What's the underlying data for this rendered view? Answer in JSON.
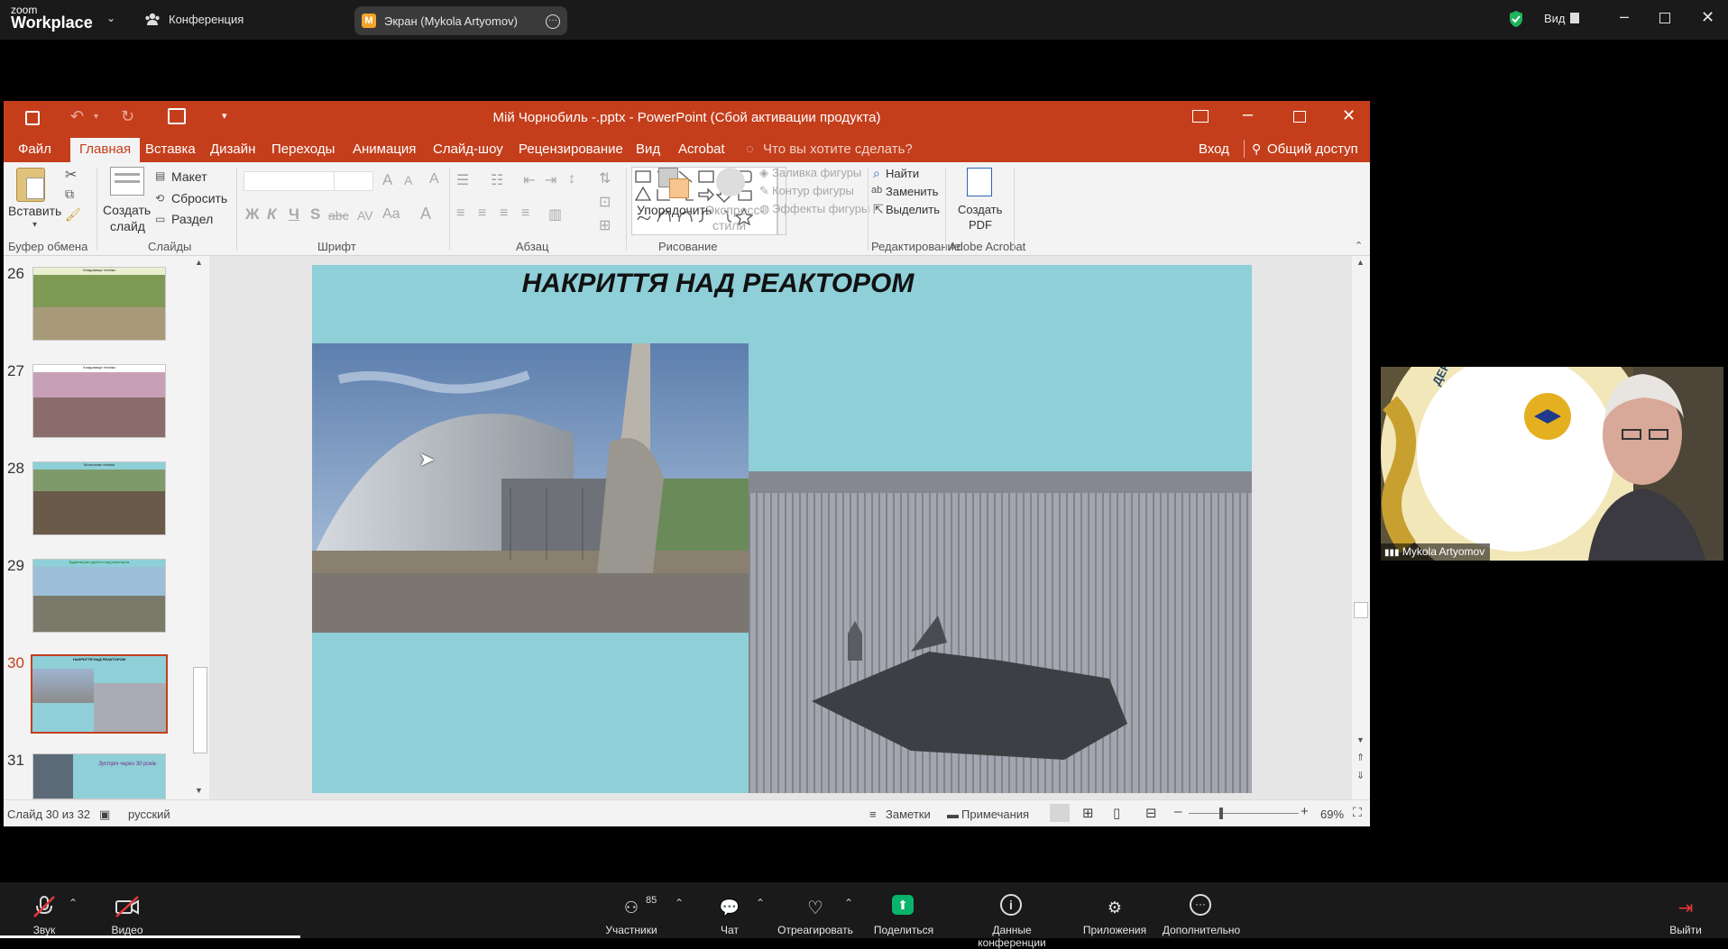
{
  "zoom_top": {
    "logo_line1": "zoom",
    "logo_line2": "Workplace",
    "meeting_label": "Конференция",
    "share_badge": "M",
    "share_label": "Экран (Mykola Artyomov)",
    "view_label": "Вид"
  },
  "ppt": {
    "window_title": "Мій Чорнобиль -.pptx - PowerPoint (Сбой активации продукта)",
    "tabs": [
      "Файл",
      "Главная",
      "Вставка",
      "Дизайн",
      "Переходы",
      "Анимация",
      "Слайд-шоу",
      "Рецензирование",
      "Вид",
      "Acrobat"
    ],
    "tell_me": "Что вы хотите сделать?",
    "signin": "Вход",
    "share": "Общий доступ",
    "ribbon": {
      "paste": "Вставить",
      "clipboard_group": "Буфер обмена",
      "new_slide_1": "Создать",
      "new_slide_2": "слайд",
      "layout": "Макет",
      "reset": "Сбросить",
      "section": "Раздел",
      "slides_group": "Слайды",
      "font_group": "Шрифт",
      "paragraph_group": "Абзац",
      "arrange": "Упорядочить",
      "quick_styles_1": "Экспресс-",
      "quick_styles_2": "стили",
      "shape_fill": "Заливка фигуры",
      "shape_outline": "Контур фигуры",
      "shape_effects": "Эффекты фигуры",
      "drawing_group": "Рисование",
      "find": "Найти",
      "replace": "Заменить",
      "select": "Выделить",
      "editing_group": "Редактирование",
      "create_pdf_1": "Создать",
      "create_pdf_2": "PDF",
      "acrobat_group": "Adobe Acrobat",
      "bold": "Ж",
      "italic": "К",
      "underline": "Ч",
      "strike": "S",
      "abc": "abc",
      "av": "AV",
      "aa": "Aa",
      "a": "A"
    },
    "thumbnails": [
      {
        "num": "26",
        "caption": "Кладовище техніки"
      },
      {
        "num": "27",
        "caption": "Кладовище техніки"
      },
      {
        "num": "28",
        "caption": "Могильник техніки"
      },
      {
        "num": "29",
        "caption": "Будівництво укриття над реактором"
      },
      {
        "num": "30",
        "caption": "НАКРИТТЯ НАД РЕАКТОРОМ"
      },
      {
        "num": "31",
        "caption": "Зустріч через 30 років"
      }
    ],
    "slide": {
      "title": "НАКРИТТЯ НАД РЕАКТОРОМ"
    },
    "status": {
      "slide_counter": "Слайд 30 из 32",
      "language": "русский",
      "notes": "Заметки",
      "comments": "Примечания",
      "zoom_minus": "–",
      "zoom_plus": "+",
      "zoom": "69%"
    }
  },
  "video": {
    "name": "Mykola Artyomov",
    "banner_text": "ДЕРЖАВНИЙ БІО"
  },
  "zoom_bottom": {
    "audio": "Звук",
    "video": "Видео",
    "participants_count": "85",
    "participants": "Участники",
    "chat": "Чат",
    "react": "Отреагировать",
    "share": "Поделиться",
    "meeting_info": "Данные конференции",
    "apps": "Приложения",
    "more": "Дополнительно",
    "leave": "Выйти"
  },
  "colors": {
    "ppt_accent": "#c43e1c",
    "slide_bg": "#8ecfd8",
    "zoom_bar": "#1a1a1a",
    "share_green": "#0ab36a"
  }
}
